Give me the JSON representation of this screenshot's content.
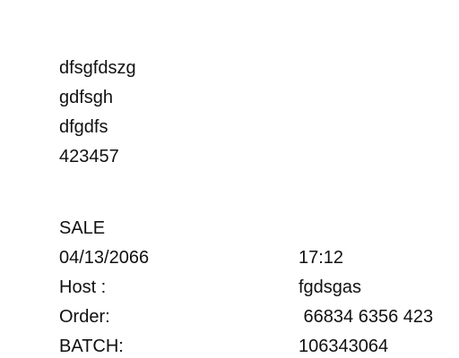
{
  "merchant": {
    "lines": [
      "dfsgfdszg",
      "gdfsgh",
      "dfgdfs",
      "423457"
    ]
  },
  "transaction": {
    "type": "SALE",
    "date": "04/13/2066",
    "time": "17:12",
    "host_label": "Host :",
    "host_value": "fgdsgas",
    "order_label": "Order:",
    "order_value": " 66834 6356 423",
    "batch_label": "BATCH:",
    "batch_value": "106343064"
  }
}
